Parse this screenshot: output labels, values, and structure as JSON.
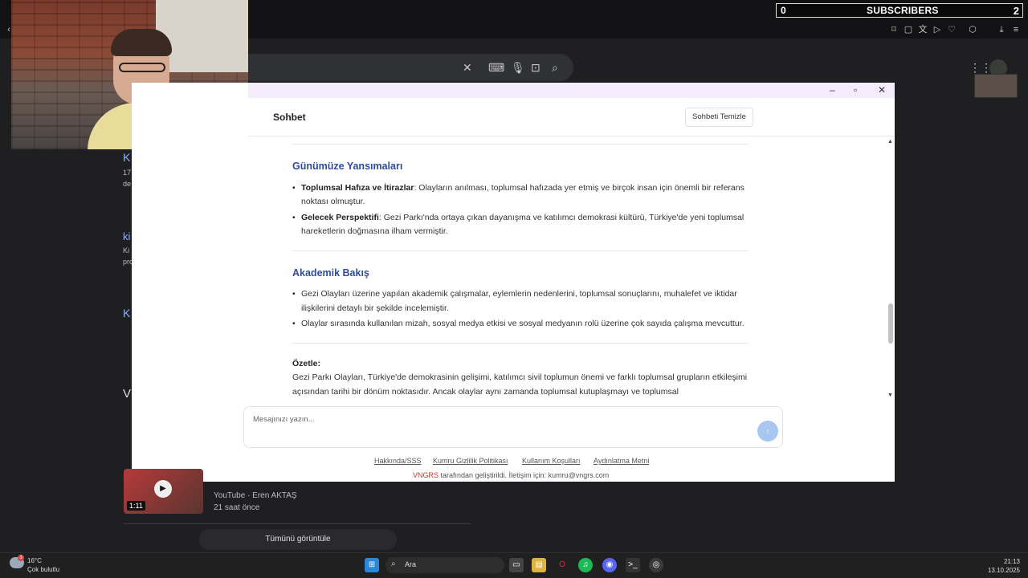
{
  "stream_overlay": {
    "subscriber_count": "0",
    "label": "SUBSCRIBERS",
    "right_count": "2"
  },
  "chat": {
    "title": "Sohbet",
    "clear_button": "Sohbeti Temizle",
    "input_placeholder": "Mesajınızı yazın...",
    "send_icon": "↑"
  },
  "message": {
    "section1_title": "Günümüze Yansımaları",
    "section1_items": [
      {
        "bold": "Toplumsal Hafıza ve İtirazlar",
        "text": ": Olayların anılması, toplumsal hafızada yer etmiş ve birçok insan için önemli bir referans noktası olmuştur."
      },
      {
        "bold": "Gelecek Perspektifi",
        "text": ": Gezi Parkı'nda ortaya çıkan dayanışma ve katılımcı demokrasi kültürü, Türkiye'de yeni toplumsal hareketlerin doğmasına ilham vermiştir."
      }
    ],
    "section2_title": "Akademik Bakış",
    "section2_items": [
      "Gezi Olayları üzerine yapılan akademik çalışmalar, eylemlerin nedenlerini, toplumsal sonuçlarını, muhalefet ve iktidar ilişkilerini detaylı bir şekilde incelemiştir.",
      "Olaylar sırasında kullanılan mizah, sosyal medya etkisi ve sosyal medyanın rolü üzerine çok sayıda çalışma mevcuttur."
    ],
    "summary_label": "Özetle:",
    "summary_text": "Gezi Parkı Olayları, Türkiye'de demokrasinin gelişimi, katılımcı sivil toplumun önemi ve farklı toplumsal grupların etkileşimi açısından tarihi bir dönüm noktasıdır. Ancak olaylar aynı zamanda toplumsal kutuplaşmayı ve toplumsal"
  },
  "footer": {
    "links": [
      "Hakkında/SSS",
      "Kumru Gizlilik Politikası",
      "Kullanım Koşulları",
      "Aydınlatma Metni"
    ],
    "brand": "VNGRS",
    "tagline": " tarafından geliştirildi. İletişim için: kumru@vngrs.com"
  },
  "google": {
    "video_duration": "1:11",
    "video_meta": "YouTube · Eren AKTAŞ",
    "video_time": "21 saat önce",
    "view_all": "Tümünü görüntüle",
    "partial_left": [
      "K",
      "17",
      "de",
      "ki",
      "Ki",
      "pro",
      "K",
      "V"
    ]
  },
  "taskbar": {
    "weather_temp": "16°C",
    "weather_desc": "Çok bulutlu",
    "weather_badge": "3",
    "search_label": "Ara",
    "time": "21:13",
    "date": "13.10.2025"
  }
}
